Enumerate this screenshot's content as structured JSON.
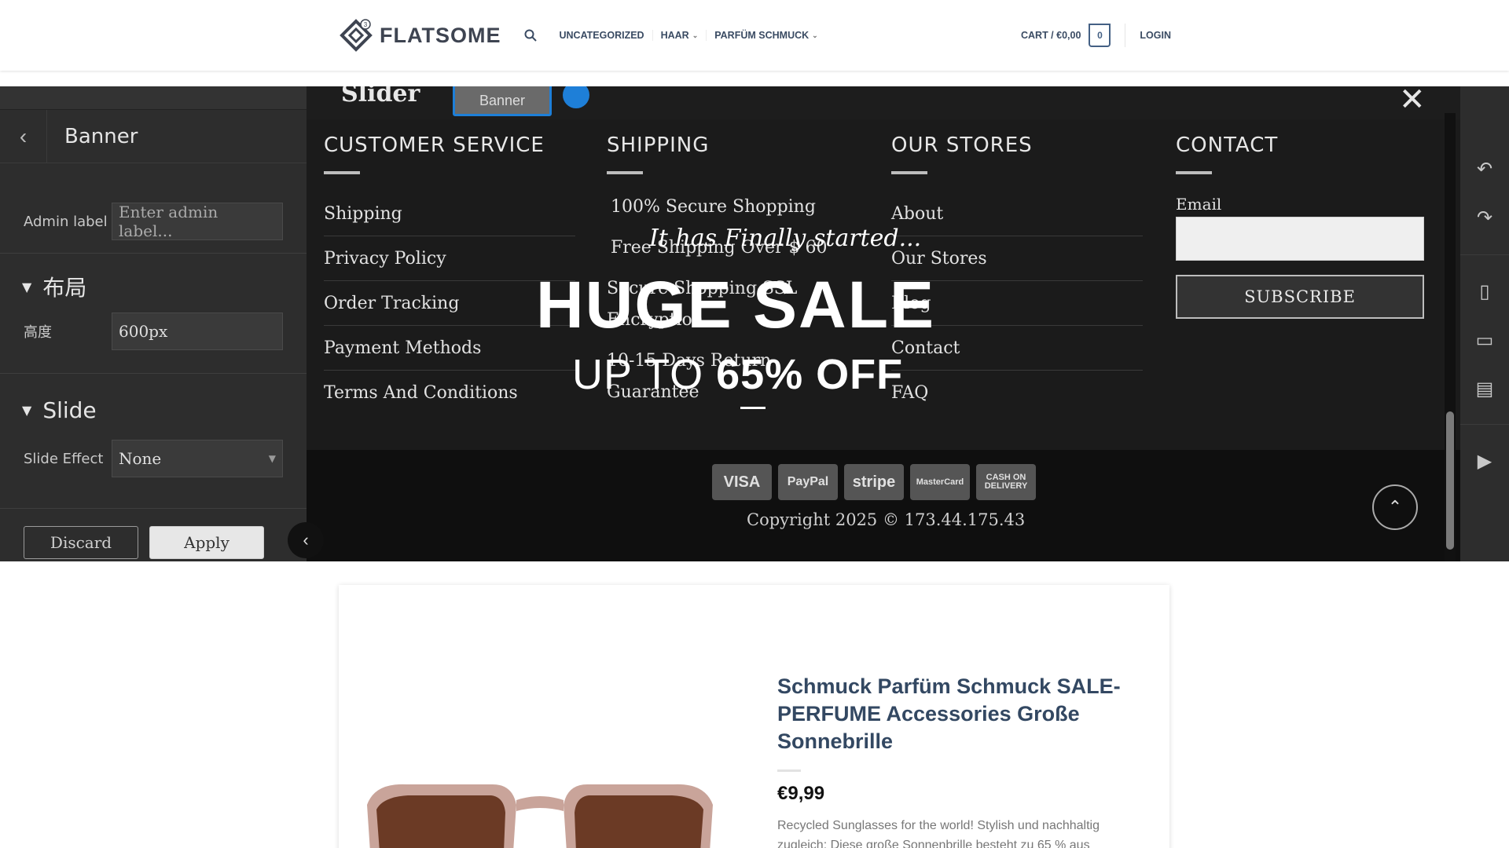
{
  "header": {
    "logo_text": "FLATSOME",
    "nav": [
      {
        "label": "UNCATEGORIZED",
        "has_dropdown": false
      },
      {
        "label": "HAAR",
        "has_dropdown": true
      },
      {
        "label": "PARFÜM SCHMUCK",
        "has_dropdown": true
      }
    ],
    "cart_label": "CART / €0,00",
    "cart_count": "0",
    "login_label": "LOGIN"
  },
  "editor_panel": {
    "back_icon": "chevron-left-icon",
    "title": "Banner",
    "admin_label": "Admin label",
    "admin_placeholder": "Enter admin label...",
    "section_layout": "布局",
    "height_label": "高度",
    "height_value": "600px",
    "section_slide": "Slide",
    "slide_effect_label": "Slide Effect",
    "slide_effect_value": "None",
    "discard_label": "Discard",
    "apply_label": "Apply"
  },
  "canvas": {
    "slider_label": "Slider",
    "banner_chip_label": "Banner"
  },
  "footer": {
    "customer_service": {
      "title": "CUSTOMER SERVICE",
      "links": [
        "Shipping",
        "Privacy Policy",
        "Order Tracking",
        "Payment Methods",
        "Terms And Conditions"
      ]
    },
    "shipping": {
      "title": "SHIPPING",
      "links": [
        "100% Secure Shopping",
        "Free Shipping Over $ 60",
        "Secure Shopping SSL Encryption",
        "10-15 Days Return Guarantee"
      ]
    },
    "stores": {
      "title": "OUR STORES",
      "links": [
        "About",
        "Our Stores",
        "Blog",
        "Contact",
        "FAQ"
      ]
    },
    "contact": {
      "title": "CONTACT",
      "email_label": "Email",
      "subscribe_label": "SUBSCRIBE"
    },
    "payments": [
      "VISA",
      "PayPal",
      "stripe",
      "MasterCard",
      "CASH ON DELIVERY"
    ],
    "copyright": "Copyright 2025 © 173.44.175.43"
  },
  "sale_overlay": {
    "script_text": "It has Finally started...",
    "headline": "HUGE SALE",
    "upto_prefix": "UP TO ",
    "upto_value": "65% OFF"
  },
  "product": {
    "title": "Schmuck Parfüm Schmuck SALE-PERFUME Accessories Große Sonnebrille",
    "price": "€9,99",
    "description": "Recycled Sunglasses for the world! Stylish und nachhaltig zugleich: Diese große Sonnenbrille besteht zu 65 % aus"
  },
  "colors": {
    "brand_blue": "#446084",
    "nav_text": "#3a4b63",
    "editor_accent": "#1e7fd8"
  }
}
